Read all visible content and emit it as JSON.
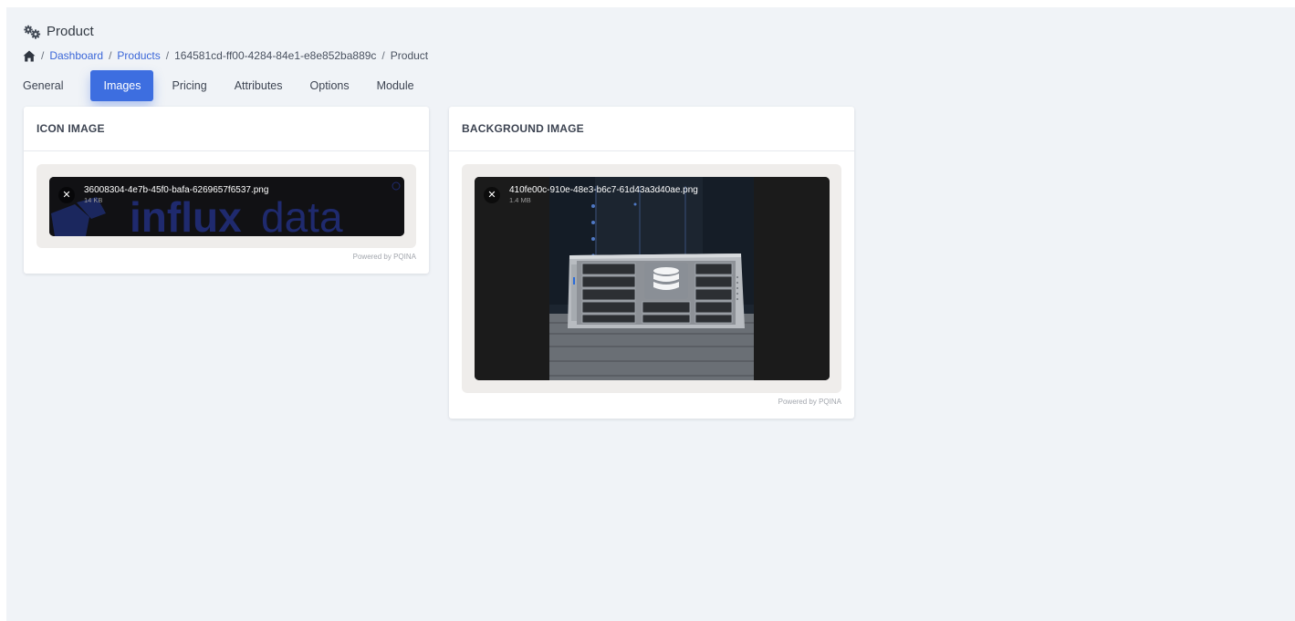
{
  "header": {
    "title": "Product",
    "title_icon": "cogs-icon"
  },
  "breadcrumb": {
    "home_icon": "home-icon",
    "separator": "/",
    "items": [
      "Dashboard",
      "Products",
      "164581cd-ff00-4284-84e1-e8e852ba889c",
      "Product"
    ]
  },
  "tabs": {
    "items": [
      "General",
      "Images",
      "Pricing",
      "Attributes",
      "Options",
      "Module"
    ],
    "active": "Images"
  },
  "icon_image": {
    "heading": "ICON IMAGE",
    "file_name": "36008304-4e7b-45f0-bafa-6269657f6537.png",
    "file_size": "14 KB",
    "preview_text": "influxdata",
    "remove_icon": "close-icon",
    "credit": "Powered by PQINA"
  },
  "background_image": {
    "heading": "BACKGROUND IMAGE",
    "file_name": "410fe00c-910e-48e3-b6c7-61d43a3d40ae.png",
    "file_size": "1.4 MB",
    "remove_icon": "close-icon",
    "credit": "Powered by PQINA"
  },
  "colors": {
    "accent": "#3d6ee0",
    "link": "#3a66d8",
    "page_bg": "#f0f3f7"
  }
}
